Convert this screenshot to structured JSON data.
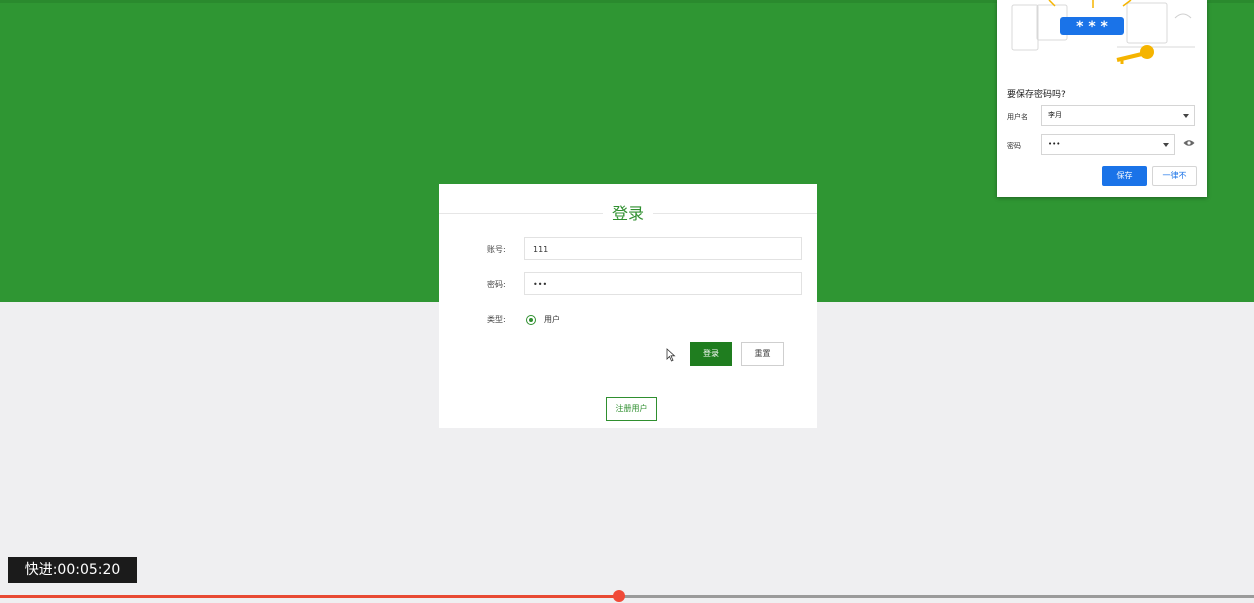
{
  "login": {
    "title": "登录",
    "account_label": "账号:",
    "account_value": "111",
    "password_label": "密码:",
    "password_value": "•••",
    "type_label": "类型:",
    "type_option": "用户",
    "login_button": "登录",
    "reset_button": "重置",
    "register_button": "注册用户"
  },
  "save_password_popup": {
    "question": "要保存密码吗?",
    "username_label": "用户名",
    "username_value": "李月",
    "password_label": "密码",
    "password_value": "•••",
    "illustration_text": "* * *",
    "save_button": "保存",
    "never_button": "一律不"
  },
  "video": {
    "fast_forward_label": "快进:00:05:20",
    "progress_fraction": 0.494
  },
  "colors": {
    "green_band": "#2f9633",
    "login_button": "#1f7d1f",
    "save_button": "#1a73e8",
    "progress": "#e84a33"
  }
}
